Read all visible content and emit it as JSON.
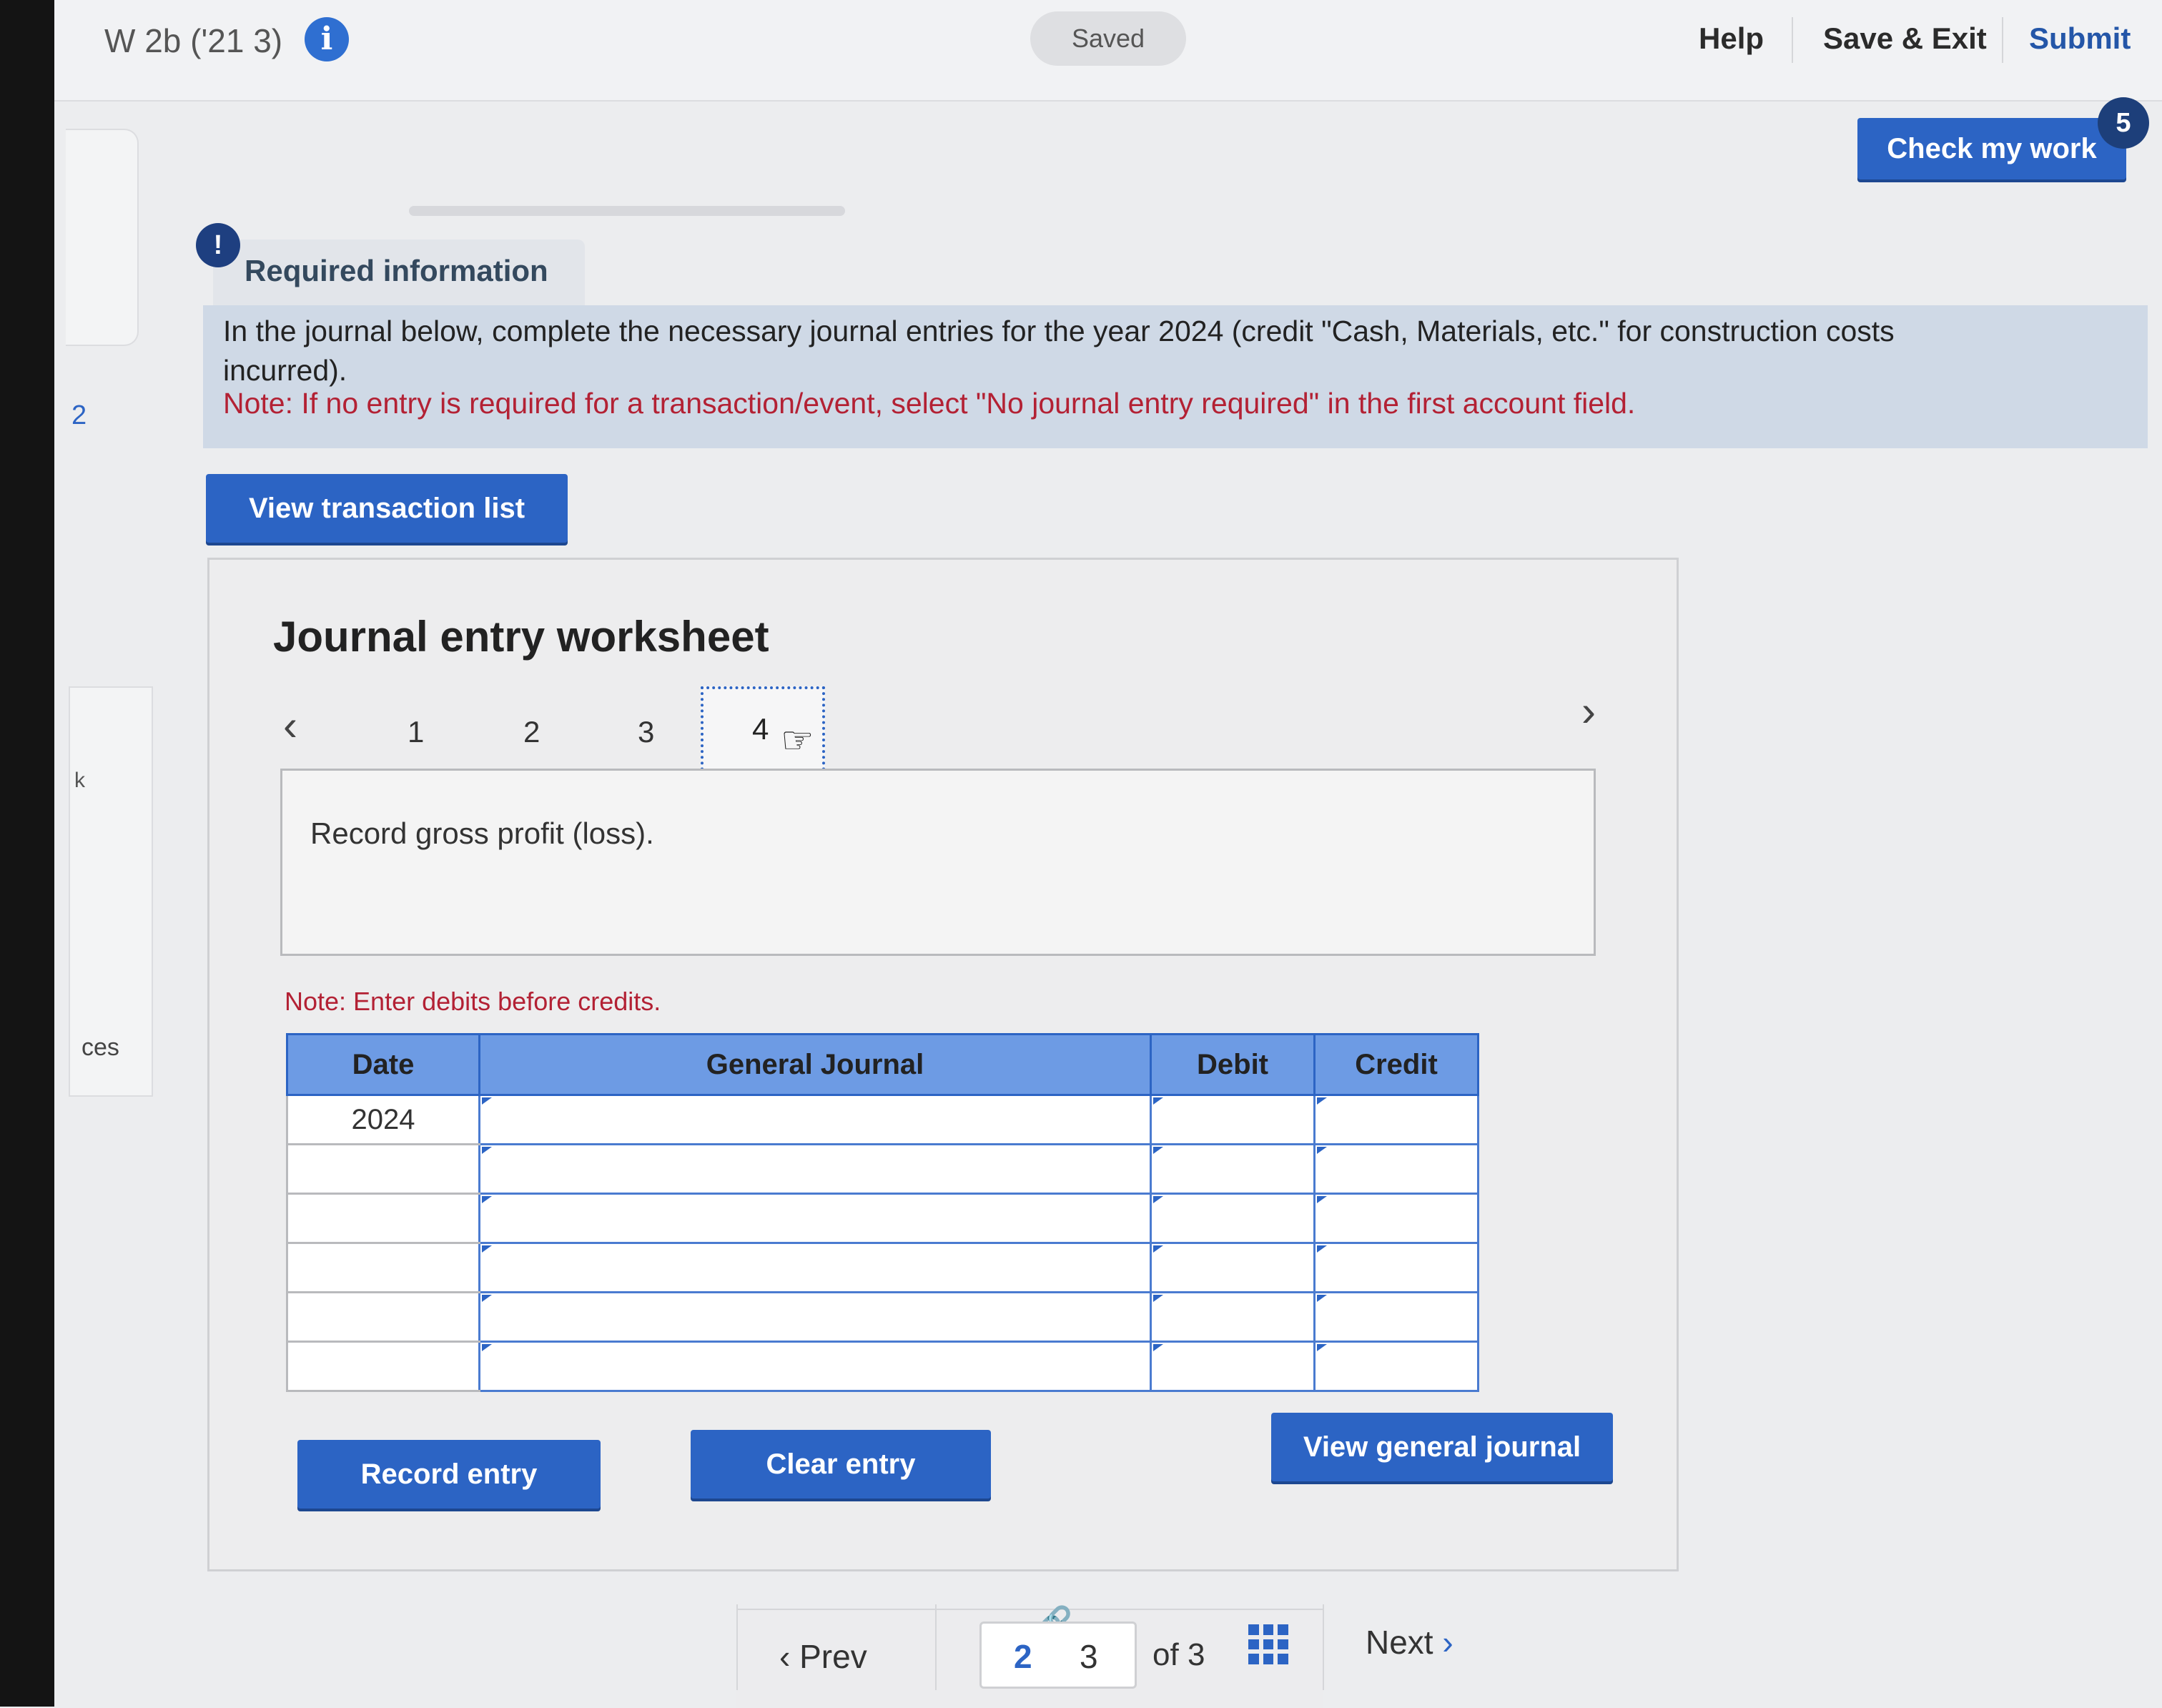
{
  "header": {
    "title": "W 2b ('21 3)",
    "saved": "Saved",
    "help": "Help",
    "save_exit": "Save & Exit",
    "submit": "Submit"
  },
  "check_work": {
    "label": "Check my work",
    "badge": "5"
  },
  "sidebar": {
    "number": "2",
    "k_label": "k",
    "resources_fragment": "ces"
  },
  "required": {
    "icon": "!",
    "label": "Required information",
    "line1": "In the journal below, complete the necessary journal entries for the year 2024 (credit \"Cash, Materials, etc.\" for construction costs",
    "line2": "incurred).",
    "note": "Note: If no entry is required for a transaction/event, select \"No journal entry required\" in the first account field."
  },
  "view_transaction_list": "View transaction list",
  "worksheet": {
    "title": "Journal entry worksheet",
    "tabs": [
      "1",
      "2",
      "3",
      "4"
    ],
    "active_tab": "4",
    "description": "Record gross profit (loss).",
    "note": "Note: Enter debits before credits.",
    "columns": {
      "date": "Date",
      "general_journal": "General Journal",
      "debit": "Debit",
      "credit": "Credit"
    },
    "rows": [
      {
        "date": "2024",
        "account": "",
        "debit": "",
        "credit": ""
      },
      {
        "date": "",
        "account": "",
        "debit": "",
        "credit": ""
      },
      {
        "date": "",
        "account": "",
        "debit": "",
        "credit": ""
      },
      {
        "date": "",
        "account": "",
        "debit": "",
        "credit": ""
      },
      {
        "date": "",
        "account": "",
        "debit": "",
        "credit": ""
      },
      {
        "date": "",
        "account": "",
        "debit": "",
        "credit": ""
      }
    ],
    "record_entry": "Record entry",
    "clear_entry": "Clear entry",
    "view_general_journal": "View general journal"
  },
  "pager": {
    "prev": "Prev",
    "current": "2",
    "next_page": "3",
    "of": "of",
    "total": "3",
    "next": "Next"
  },
  "icons": {
    "info": "info-icon",
    "link": "link-icon",
    "grid": "grid-icon",
    "chevron_left": "chevron-left-icon",
    "chevron_right": "chevron-right-icon"
  }
}
